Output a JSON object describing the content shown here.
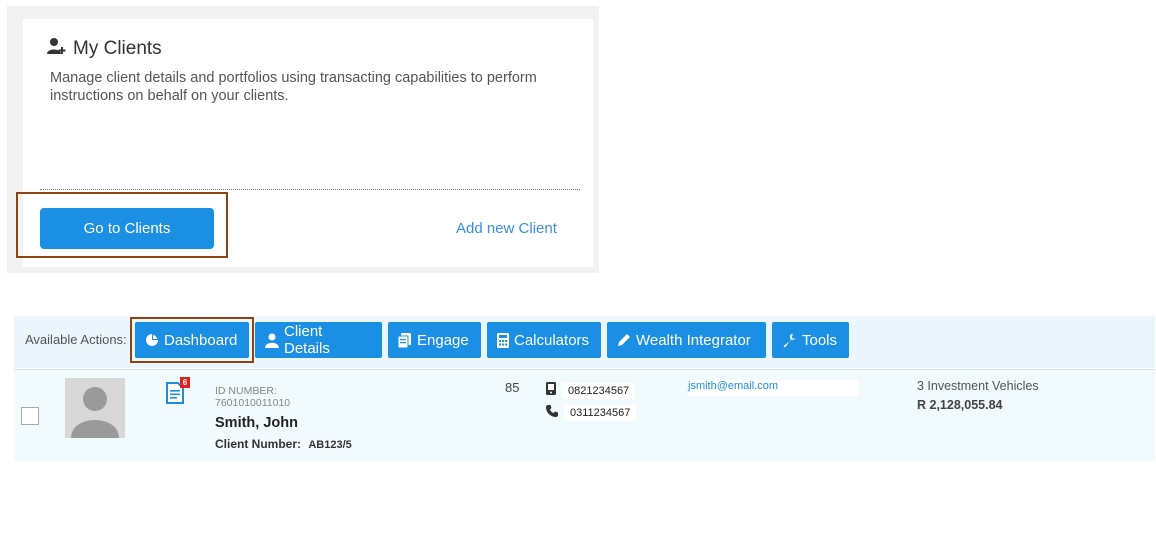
{
  "card": {
    "title": "My Clients",
    "icon": "add-user-icon",
    "description": "Manage client details and portfolios using transacting capabilities to perform instructions on behalf on your clients.",
    "primary_button": "Go to Clients",
    "secondary_link": "Add new Client"
  },
  "actions": {
    "label": "Available Actions:",
    "buttons": [
      {
        "label": "Dashboard",
        "icon": "pie-chart-icon"
      },
      {
        "label": "Client Details",
        "icon": "user-icon"
      },
      {
        "label": "Engage",
        "icon": "documents-icon"
      },
      {
        "label": "Calculators",
        "icon": "calculator-icon"
      },
      {
        "label": "Wealth Integrator",
        "icon": "pencil-icon"
      },
      {
        "label": "Tools",
        "icon": "wrench-icon"
      }
    ]
  },
  "client": {
    "badge_count": "6",
    "id_label": "ID NUMBER:",
    "id_number": "7601010011010",
    "name": "Smith, John",
    "client_number_label": "Client Number:",
    "client_number": "AB123/5",
    "age": "85",
    "mobile": "0821234567",
    "phone": "0311234567",
    "email": "jsmith@email.com",
    "vehicles": "3 Investment Vehicles",
    "amount": "R 2,128,055.84"
  },
  "colors": {
    "primary": "#1a8fe3",
    "highlight_border": "#8b4513",
    "row_background": "#f1fafc",
    "badge": "#e0201a"
  }
}
